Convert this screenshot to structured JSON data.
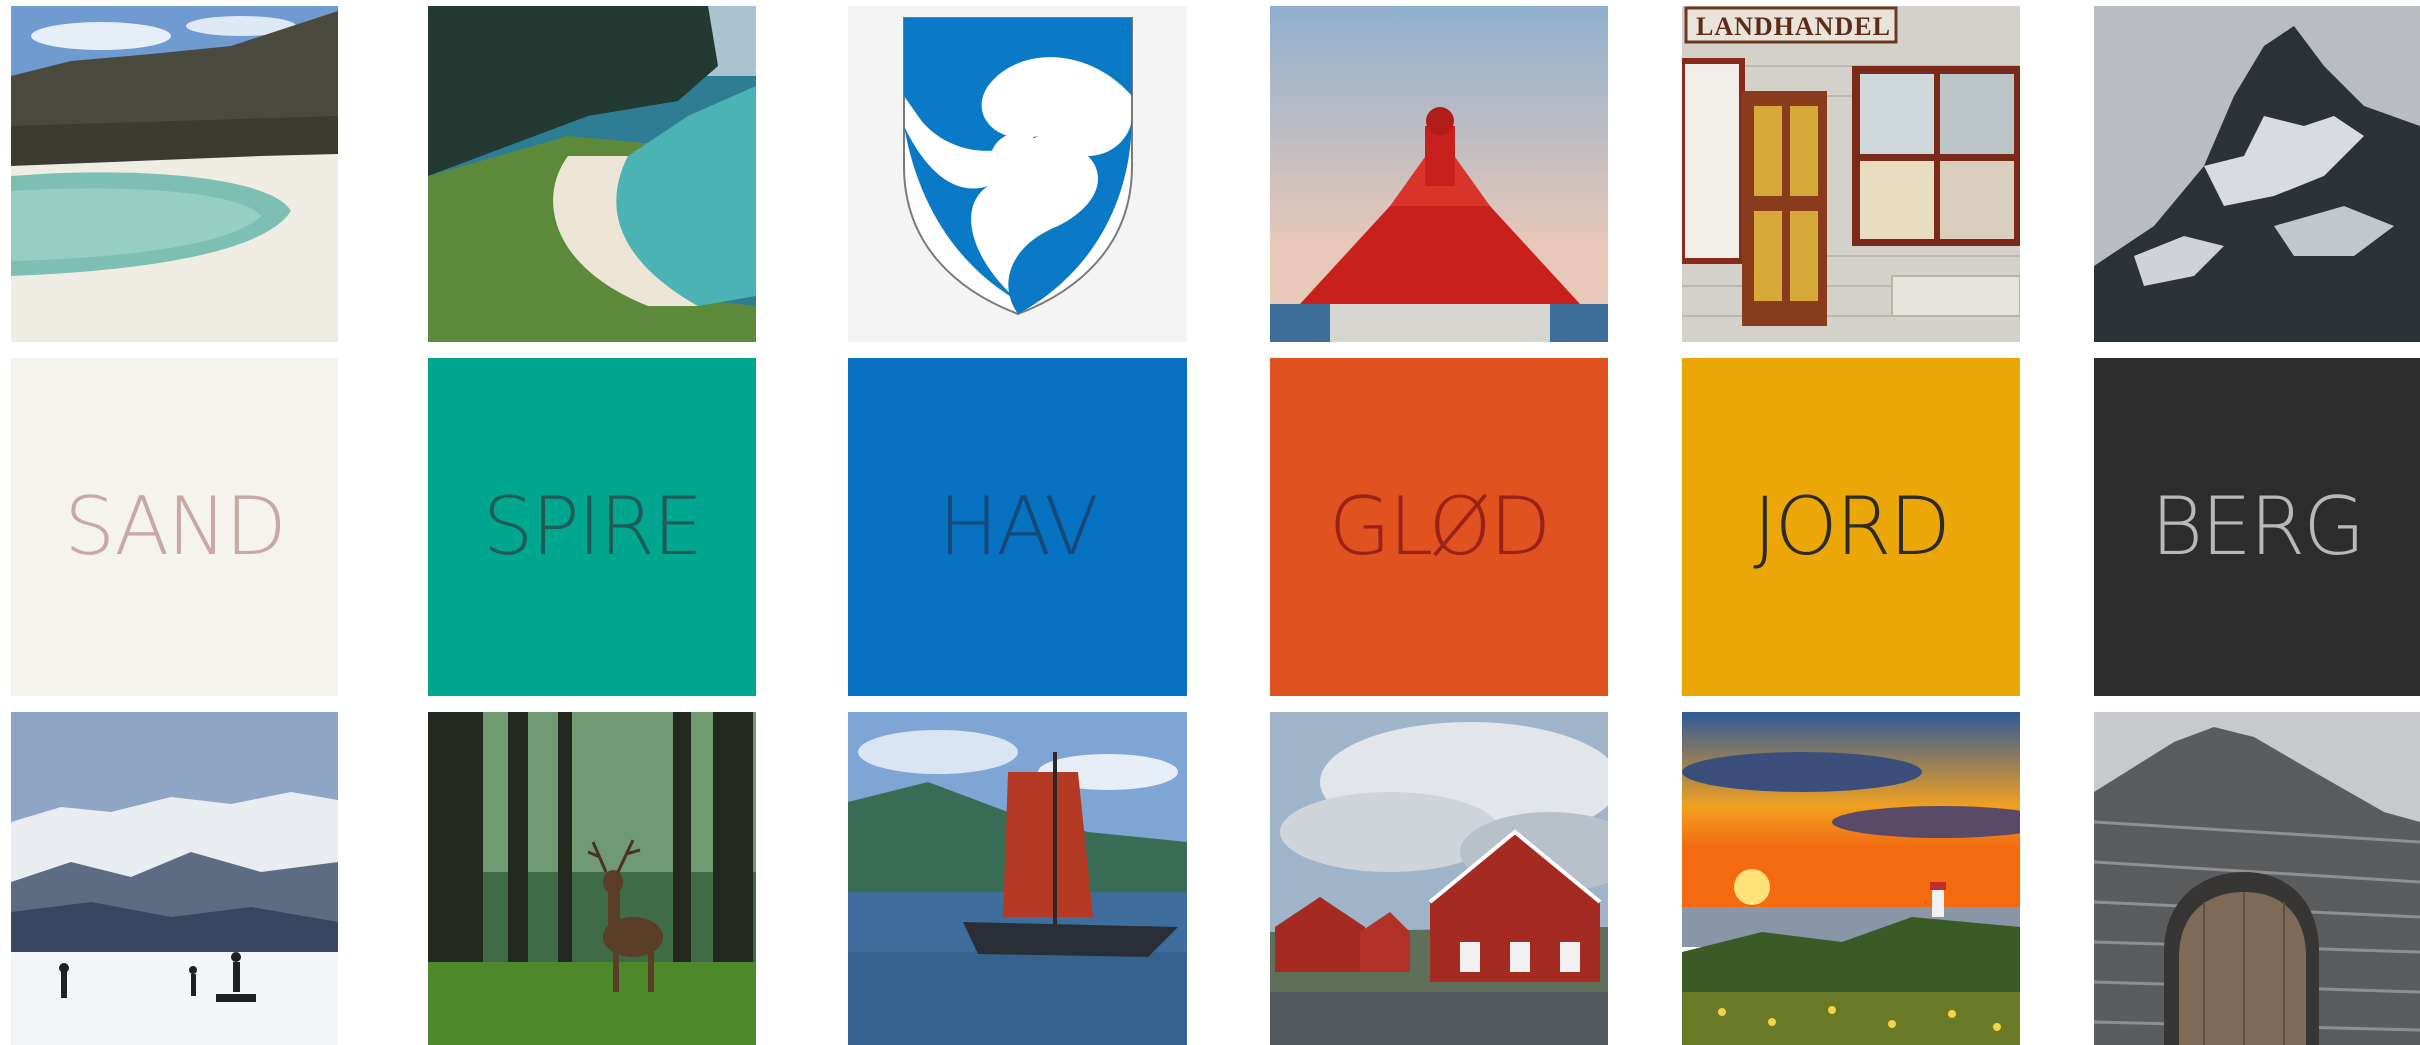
{
  "swatches": [
    {
      "label": "SAND",
      "bg": "#f4f3ee",
      "fg": "#c7a8a6"
    },
    {
      "label": "SPIRE",
      "bg": "#00a78e",
      "fg": "#1f5b57"
    },
    {
      "label": "HAV",
      "bg": "#0872c2",
      "fg": "#164878"
    },
    {
      "label": "GLØD",
      "bg": "#e05321",
      "fg": "#9a2218"
    },
    {
      "label": "JORD",
      "bg": "#eba708",
      "fg": "#2b2b2b"
    },
    {
      "label": "BERG",
      "bg": "#2d2d2d",
      "fg": "#b8b8b8"
    }
  ],
  "photos": {
    "shop_sign": "LANDHANDEL"
  }
}
